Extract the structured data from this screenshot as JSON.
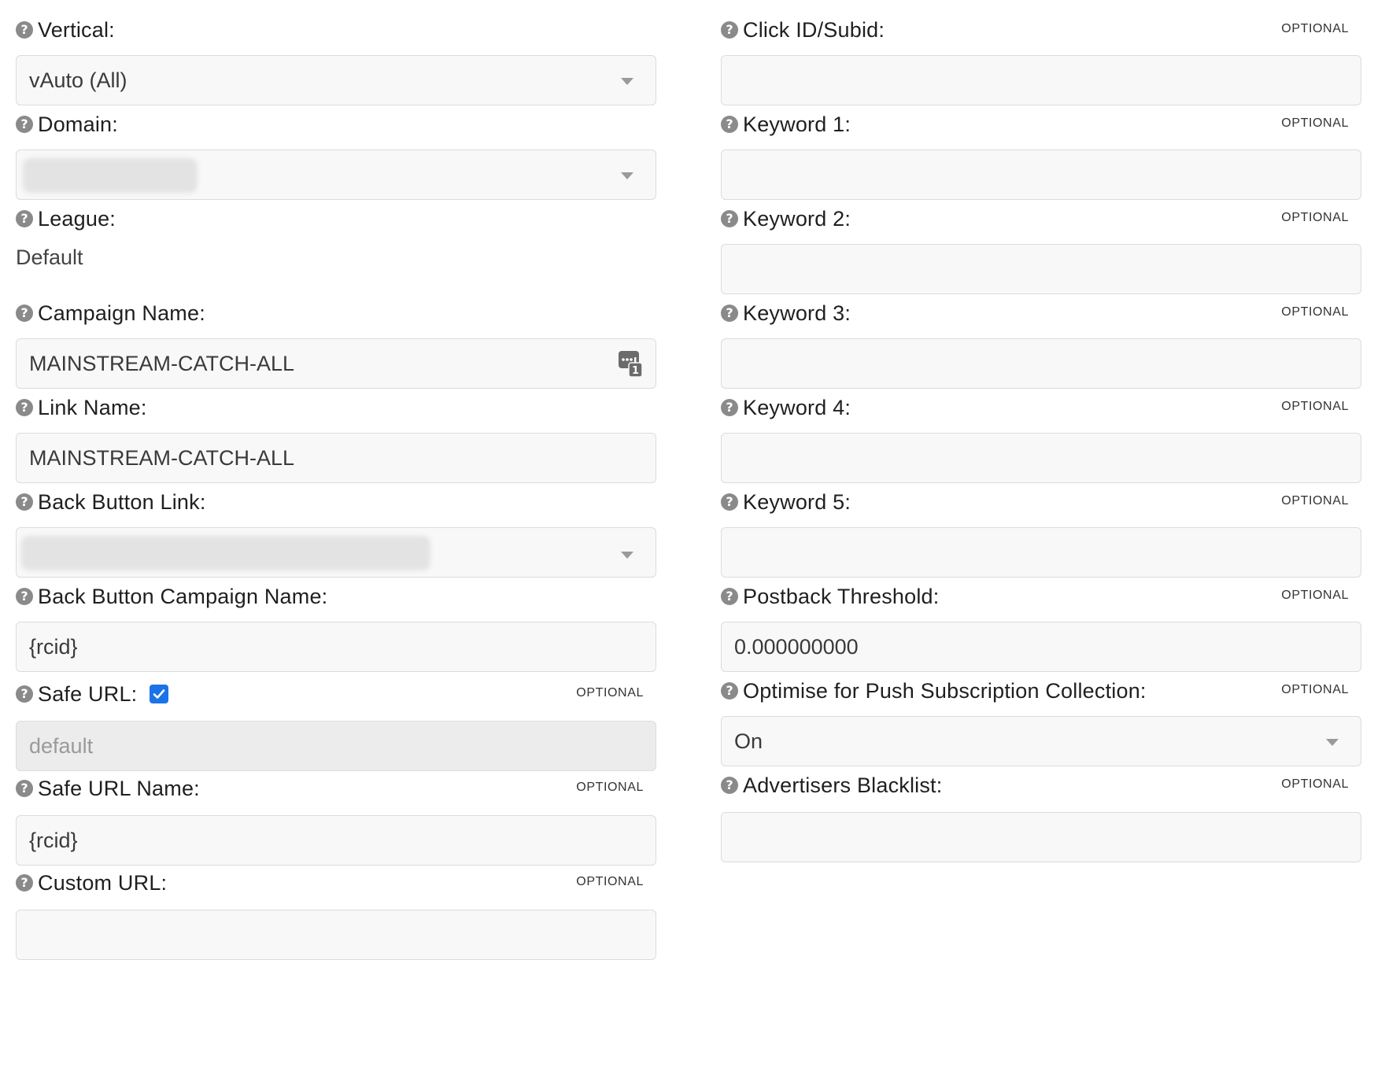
{
  "optional_label": "OPTIONAL",
  "help_glyph": "?",
  "left_fields": {
    "vertical": {
      "label": "Vertical:",
      "value": "vAuto (All)"
    },
    "domain": {
      "label": "Domain:",
      "value": ""
    },
    "league": {
      "label": "League:",
      "value": "Default"
    },
    "campaign_name": {
      "label": "Campaign Name:",
      "value": "MAINSTREAM-CATCH-ALL",
      "counter_badge": "1"
    },
    "link_name": {
      "label": "Link Name:",
      "value": "MAINSTREAM-CATCH-ALL"
    },
    "back_button_link": {
      "label": "Back Button Link:",
      "value": ""
    },
    "back_button_campaign_name": {
      "label": "Back Button Campaign Name:",
      "value": "{rcid}"
    },
    "safe_url": {
      "label": "Safe URL:",
      "checked": true,
      "value": "default"
    },
    "safe_url_name": {
      "label": "Safe URL Name:",
      "value": "{rcid}"
    },
    "custom_url": {
      "label": "Custom URL:",
      "value": ""
    }
  },
  "right_fields": {
    "click_id": {
      "label": "Click ID/Subid:",
      "value": ""
    },
    "keyword1": {
      "label": "Keyword 1:",
      "value": ""
    },
    "keyword2": {
      "label": "Keyword 2:",
      "value": ""
    },
    "keyword3": {
      "label": "Keyword 3:",
      "value": ""
    },
    "keyword4": {
      "label": "Keyword 4:",
      "value": ""
    },
    "keyword5": {
      "label": "Keyword 5:",
      "value": ""
    },
    "postback_threshold": {
      "label": "Postback Threshold:",
      "value": "0.000000000"
    },
    "optimise_push": {
      "label": "Optimise for Push Subscription Collection:",
      "value": "On"
    },
    "advertisers_blacklist": {
      "label": "Advertisers Blacklist:",
      "value": ""
    }
  },
  "colors": {
    "checkbox_accent": "#1a73e8",
    "field_background": "#f8f8f8",
    "field_border": "#dcdcdc",
    "disabled_background": "#ececec",
    "help_icon": "#8a8a8a"
  }
}
